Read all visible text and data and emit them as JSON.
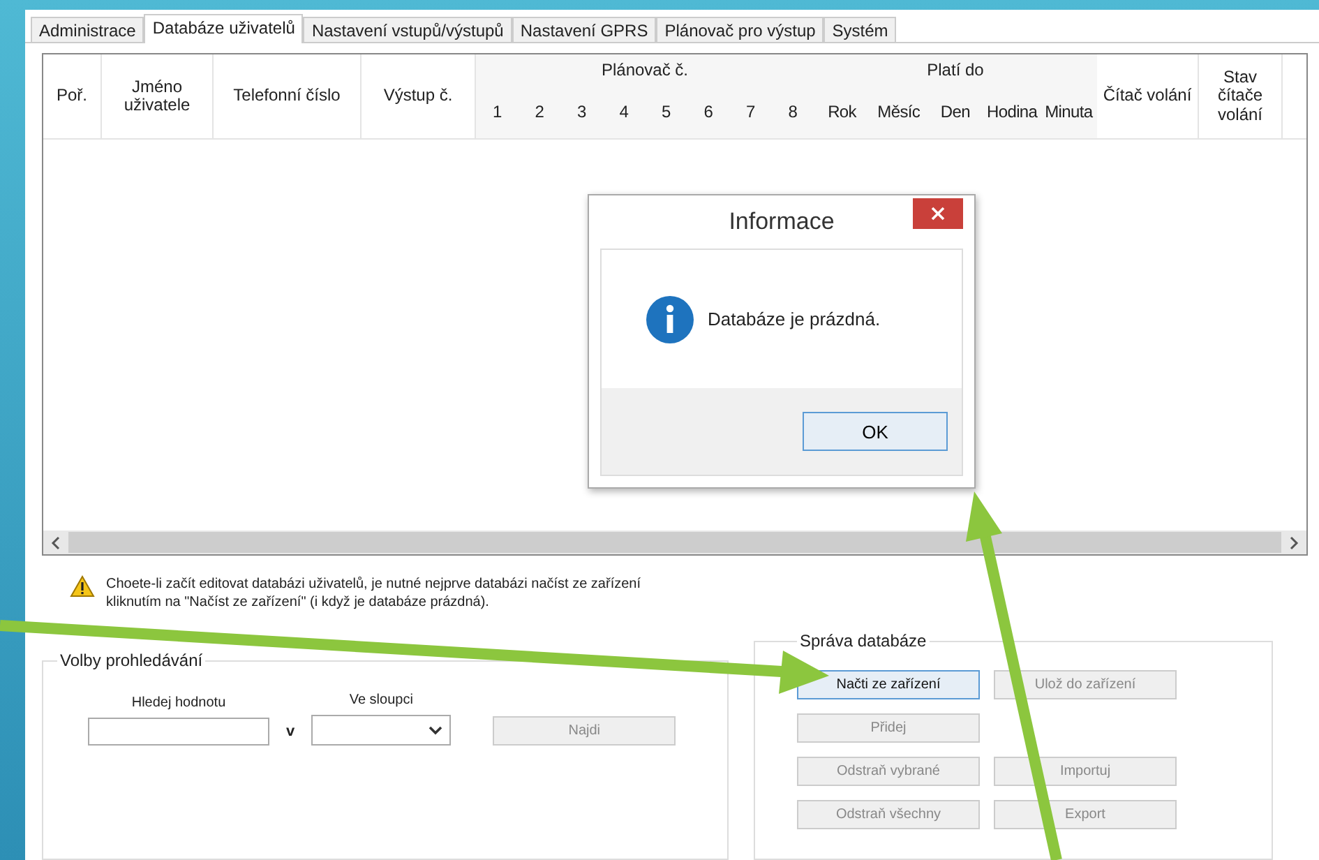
{
  "tabs": [
    {
      "label": "Administrace",
      "selected": false
    },
    {
      "label": "Databáze uživatelů",
      "selected": true
    },
    {
      "label": "Nastavení vstupů/výstupů",
      "selected": false
    },
    {
      "label": "Nastavení GPRS",
      "selected": false
    },
    {
      "label": "Plánovač pro výstup",
      "selected": false
    },
    {
      "label": "Systém",
      "selected": false
    }
  ],
  "table": {
    "columns": [
      {
        "kind": "single",
        "label": "Poř."
      },
      {
        "kind": "single",
        "label": "Jméno uživatele"
      },
      {
        "kind": "single",
        "label": "Telefonní číslo"
      },
      {
        "kind": "single",
        "label": "Výstup č."
      },
      {
        "kind": "group",
        "label": "Plánovač č.",
        "children": [
          "1",
          "2",
          "3",
          "4",
          "5",
          "6",
          "7",
          "8"
        ]
      },
      {
        "kind": "group",
        "label": "Platí do",
        "children": [
          "Rok",
          "Měsíc",
          "Den",
          "Hodina",
          "Minuta"
        ]
      },
      {
        "kind": "single",
        "label": "Čítač volání"
      },
      {
        "kind": "single",
        "label": "Stav čítače volání"
      }
    ]
  },
  "warning": {
    "lines": [
      "Choete-li začít editovat databázi uživatelů, je nutné nejprve databázi načíst ze zařízení",
      "kliknutím na \"Načíst ze zařízení\" (i když je databáze prázdná)."
    ]
  },
  "search_group": {
    "title": "Volby prohledávání",
    "value_label": "Hledej hodnotu",
    "column_label": "Ve sloupci",
    "connector": "v",
    "find_button": "Najdi"
  },
  "db_group": {
    "title": "Správa databáze",
    "rows": [
      [
        {
          "label": "Načti ze zařízení",
          "disabled": false
        },
        {
          "label": "Ulož do zařízení",
          "disabled": true
        }
      ],
      [
        {
          "label": "Přidej",
          "disabled": true
        }
      ],
      [
        {
          "label": "Odstraň vybrané",
          "disabled": true
        },
        {
          "label": "Importuj",
          "disabled": true
        }
      ],
      [
        {
          "label": "Odstraň všechny",
          "disabled": true
        },
        {
          "label": "Export",
          "disabled": true
        }
      ]
    ]
  },
  "dialog": {
    "title": "Informace",
    "message": "Databáze je prázdná.",
    "button": "OK"
  }
}
